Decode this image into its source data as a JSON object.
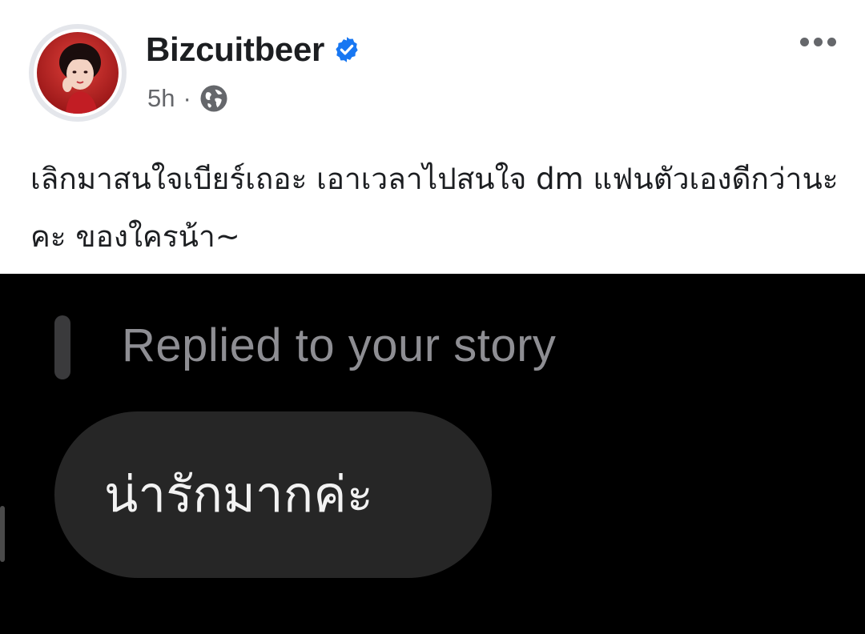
{
  "post": {
    "author_name": "Bizcuitbeer",
    "timestamp": "5h",
    "separator": "·",
    "verified_icon": "verified-badge-icon",
    "audience_icon": "globe-icon",
    "more_icon": "more-options-icon",
    "caption": "เลิกมาสนใจเบียร์เถอะ เอาเวลาไปสนใจ dm แฟนตัวเองดีกว่านะคะ ของใครน้า~"
  },
  "story_reply": {
    "label": "Replied to your story",
    "message": "น่ารักมากค่ะ"
  },
  "colors": {
    "verified_blue": "#1877f2",
    "meta_gray": "#65676b",
    "dm_background": "#000000",
    "bubble": "#262626"
  }
}
